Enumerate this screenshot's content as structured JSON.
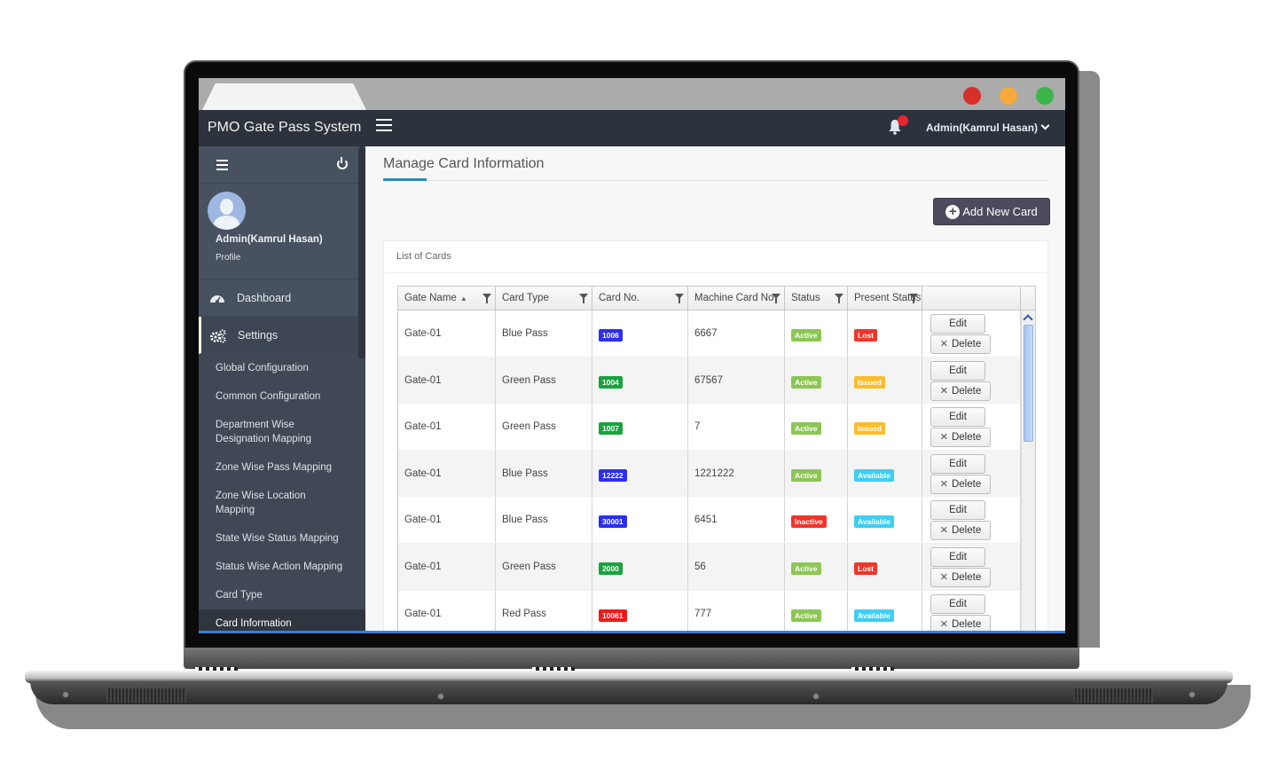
{
  "app": {
    "title": "PMO Gate Pass System",
    "user_menu": "Admin(Kamrul Hasan)"
  },
  "browser": {
    "traffic_lights": [
      {
        "name": "close",
        "color": "#d7302a"
      },
      {
        "name": "minimize",
        "color": "#f6a83a"
      },
      {
        "name": "maximize",
        "color": "#3cb54a"
      }
    ]
  },
  "sidebar": {
    "profile": {
      "name": "Admin(Kamrul Hasan)",
      "link": "Profile"
    },
    "main_items": [
      {
        "label": "Dashboard",
        "icon": "dashboard-icon"
      },
      {
        "label": "Settings",
        "icon": "gears-icon"
      }
    ],
    "sub_items": [
      {
        "label": "Global Configuration"
      },
      {
        "label": "Common Configuration"
      },
      {
        "label": "Department Wise Designation Mapping"
      },
      {
        "label": "Zone Wise Pass Mapping"
      },
      {
        "label": "Zone Wise Location Mapping"
      },
      {
        "label": "State Wise Status Mapping"
      },
      {
        "label": "Status Wise Action Mapping"
      },
      {
        "label": "Card Type"
      },
      {
        "label": "Card Information"
      }
    ]
  },
  "main": {
    "page_title": "Manage Card Information",
    "add_button": "Add New Card",
    "panel_title": "List of Cards",
    "columns": [
      "Gate Name",
      "Card Type",
      "Card No.",
      "Machine Card No",
      "Status",
      "Present Status",
      ""
    ],
    "sort_indicator": "▲",
    "actions": {
      "edit": "Edit",
      "delete": "Delete"
    },
    "rows": [
      {
        "gate": "Gate-01",
        "card_type": "Blue Pass",
        "card_no": "1006",
        "card_color": "#2b2ff0",
        "machine_no": "6667",
        "status": "Active",
        "status_color": "#8cc653",
        "present": "Lost",
        "present_color": "#f1352b"
      },
      {
        "gate": "Gate-01",
        "card_type": "Green Pass",
        "card_no": "1004",
        "card_color": "#18a33d",
        "machine_no": "67567",
        "status": "Active",
        "status_color": "#8cc653",
        "present": "Issued",
        "present_color": "#fbbd2c"
      },
      {
        "gate": "Gate-01",
        "card_type": "Green Pass",
        "card_no": "1007",
        "card_color": "#18a33d",
        "machine_no": "7",
        "status": "Active",
        "status_color": "#8cc653",
        "present": "Issued",
        "present_color": "#fbbd2c"
      },
      {
        "gate": "Gate-01",
        "card_type": "Blue Pass",
        "card_no": "12222",
        "card_color": "#2b2ff0",
        "machine_no": "1221222",
        "status": "Active",
        "status_color": "#8cc653",
        "present": "Available",
        "present_color": "#3fcdf3"
      },
      {
        "gate": "Gate-01",
        "card_type": "Blue Pass",
        "card_no": "30001",
        "card_color": "#2b2ff0",
        "machine_no": "6451",
        "status": "Inactive",
        "status_color": "#f1352b",
        "present": "Available",
        "present_color": "#3fcdf3"
      },
      {
        "gate": "Gate-01",
        "card_type": "Green Pass",
        "card_no": "2000",
        "card_color": "#18a33d",
        "machine_no": "56",
        "status": "Active",
        "status_color": "#8cc653",
        "present": "Lost",
        "present_color": "#f1352b"
      },
      {
        "gate": "Gate-01",
        "card_type": "Red Pass",
        "card_no": "10061",
        "card_color": "#f01a1a",
        "machine_no": "777",
        "status": "Active",
        "status_color": "#8cc653",
        "present": "Available",
        "present_color": "#3fcdf3"
      }
    ]
  }
}
